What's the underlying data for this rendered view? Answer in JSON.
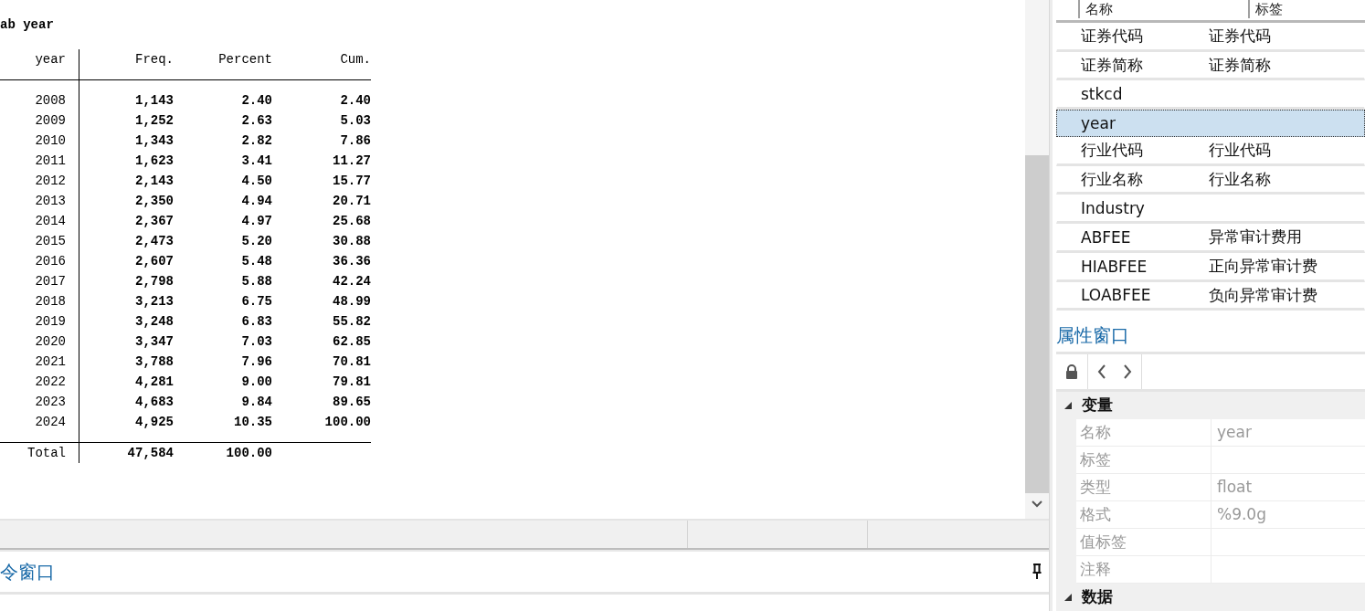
{
  "output": {
    "command": "ab year",
    "table": {
      "columns": [
        "year",
        "Freq.",
        "Percent",
        "Cum."
      ],
      "rows": [
        [
          "2008",
          "1,143",
          "2.40",
          "2.40"
        ],
        [
          "2009",
          "1,252",
          "2.63",
          "5.03"
        ],
        [
          "2010",
          "1,343",
          "2.82",
          "7.86"
        ],
        [
          "2011",
          "1,623",
          "3.41",
          "11.27"
        ],
        [
          "2012",
          "2,143",
          "4.50",
          "15.77"
        ],
        [
          "2013",
          "2,350",
          "4.94",
          "20.71"
        ],
        [
          "2014",
          "2,367",
          "4.97",
          "25.68"
        ],
        [
          "2015",
          "2,473",
          "5.20",
          "30.88"
        ],
        [
          "2016",
          "2,607",
          "5.48",
          "36.36"
        ],
        [
          "2017",
          "2,798",
          "5.88",
          "42.24"
        ],
        [
          "2018",
          "3,213",
          "6.75",
          "48.99"
        ],
        [
          "2019",
          "3,248",
          "6.83",
          "55.82"
        ],
        [
          "2020",
          "3,347",
          "7.03",
          "62.85"
        ],
        [
          "2021",
          "3,788",
          "7.96",
          "70.81"
        ],
        [
          "2022",
          "4,281",
          "9.00",
          "79.81"
        ],
        [
          "2023",
          "4,683",
          "9.84",
          "89.65"
        ],
        [
          "2024",
          "4,925",
          "10.35",
          "100.00"
        ]
      ],
      "total": [
        "Total",
        "47,584",
        "100.00"
      ]
    }
  },
  "command_window": {
    "title": "令窗口"
  },
  "variables": {
    "columns": [
      "名称",
      "标签"
    ],
    "rows": [
      {
        "name": "证券代码",
        "label": "证券代码",
        "selected": false
      },
      {
        "name": "证券简称",
        "label": "证券简称",
        "selected": false
      },
      {
        "name": "stkcd",
        "selected": false
      },
      {
        "name": "year",
        "selected": true
      },
      {
        "name": "行业代码",
        "label": "行业代码",
        "selected": false
      },
      {
        "name": "行业名称",
        "label": "行业名称",
        "selected": false
      },
      {
        "name": "Industry",
        "selected": false
      },
      {
        "name": "ABFEE",
        "label": "异常审计费用",
        "selected": false
      },
      {
        "name": "HIABFEE",
        "label": "正向异常审计费",
        "selected": false
      },
      {
        "name": "LOABFEE",
        "label": "负向异常审计费",
        "selected": false
      }
    ]
  },
  "properties": {
    "title": "属性窗口",
    "sections": [
      {
        "title": "变量",
        "expanded": true,
        "rows": [
          {
            "key": "名称",
            "value": "year"
          },
          {
            "key": "标签"
          },
          {
            "key": "类型",
            "value": "float"
          },
          {
            "key": "格式",
            "value": "%9.0g"
          },
          {
            "key": "值标签"
          },
          {
            "key": "注释"
          }
        ]
      },
      {
        "title": "数据",
        "expanded": true
      }
    ]
  }
}
